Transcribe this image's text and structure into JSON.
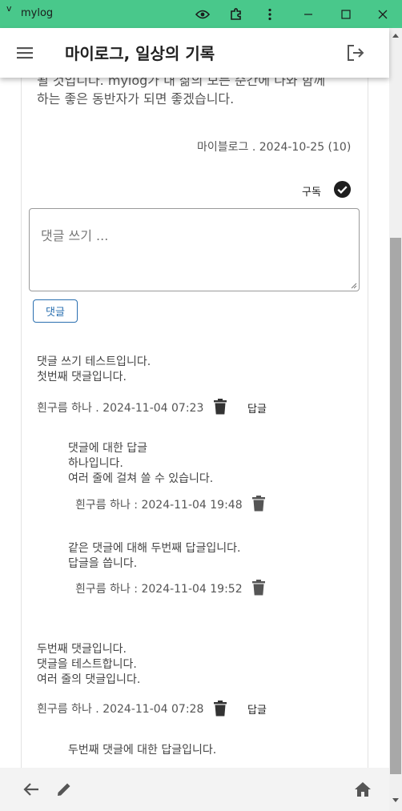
{
  "window": {
    "app_name": "mylog",
    "menu_glyph": "v"
  },
  "appbar": {
    "title": "마이로그, 일상의 기록"
  },
  "post": {
    "body_partial_line": "될 것입니다. mylog가 내 삶의 모든 순간에 나와 함께",
    "body_last_line": "하는 좋은 동반자가 되면 좋겠습니다.",
    "meta": "마이블로그 . 2024-10-25 (10)",
    "subscribe_label": "구독"
  },
  "comment_form": {
    "placeholder": "댓글 쓰기 ...",
    "submit_label": "댓글"
  },
  "comments": [
    {
      "text": "댓글 쓰기 테스트입니다.\n첫번째 댓글입니다.",
      "meta": "흰구름 하나 . 2024-11-04 07:23",
      "reply_label": "답글",
      "replies": [
        {
          "text": "댓글에 대한 답글\n하나입니다.\n여러 줄에 걸쳐 쓸 수 있습니다.",
          "meta": "흰구름 하나 : 2024-11-04 19:48"
        },
        {
          "text": "같은 댓글에 대해 두번째 답글입니다.\n답글을 씁니다.",
          "meta": "흰구름 하나 : 2024-11-04 19:52"
        }
      ]
    },
    {
      "text": "두번째 댓글입니다.\n댓글을 테스트합니다.\n여러 줄의 댓글입니다.",
      "meta": "흰구름 하나 . 2024-11-04 07:28",
      "reply_label": "답글",
      "replies": [
        {
          "text": "두번째 댓글에 대한 답글입니다."
        }
      ]
    }
  ],
  "icons": {
    "titlebar": [
      "eye-icon",
      "extension-icon",
      "more-vert-icon",
      "minimize-icon",
      "maximize-icon",
      "close-icon"
    ],
    "appbar": [
      "menu-icon",
      "logout-icon"
    ],
    "bottombar": [
      "back-arrow-icon",
      "edit-icon",
      "home-icon"
    ],
    "content": [
      "check-circle-icon",
      "trash-icon"
    ]
  },
  "colors": {
    "titlebar": "#49c88b",
    "accent": "#2a6fb0"
  }
}
